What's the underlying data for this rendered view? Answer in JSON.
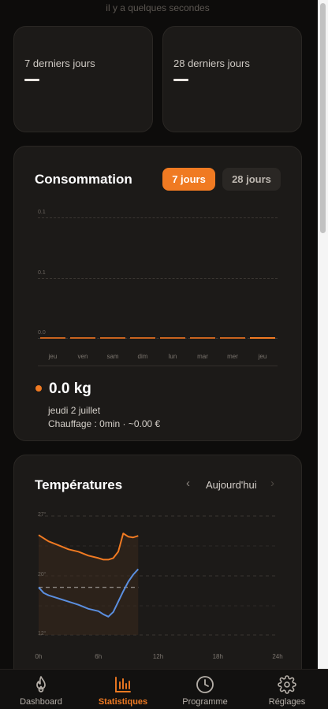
{
  "header": {
    "updated": "il y a quelques secondes"
  },
  "stats": [
    {
      "label": "7 derniers jours",
      "value": "—"
    },
    {
      "label": "28 derniers jours",
      "value": "—"
    }
  ],
  "consumption": {
    "title": "Consommation",
    "tabs": [
      {
        "label": "7 jours",
        "active": true
      },
      {
        "label": "28 jours",
        "active": false
      }
    ],
    "y_ticks": [
      "0.1",
      "0.1",
      "0.0"
    ],
    "summary": {
      "value": "0.0 kg",
      "date": "jeudi 2 juillet",
      "detail": "Chauffage : 0min · ~0.00 €"
    }
  },
  "temperatures": {
    "title": "Températures",
    "period": "Aujourd'hui",
    "prev_icon": "chevron-left-icon",
    "next_icon": "chevron-right-icon",
    "y_ticks": [
      "27°",
      "20°",
      "12°"
    ],
    "x_ticks": [
      "0h",
      "6h",
      "12h",
      "18h",
      "24h"
    ]
  },
  "chart_data": [
    {
      "type": "bar",
      "title": "Consommation",
      "categories": [
        "jeu",
        "ven",
        "sam",
        "dim",
        "lun",
        "mar",
        "mer",
        "jeu"
      ],
      "values": [
        0,
        0,
        0,
        0,
        0,
        0,
        0,
        0
      ],
      "y_ticks": [
        "0.1",
        "0.1",
        "0.0"
      ],
      "grid": true
    },
    {
      "type": "line",
      "title": "Températures",
      "x_ticks": [
        "0h",
        "6h",
        "12h",
        "18h",
        "24h"
      ],
      "y_ticks": [
        "27°",
        "20°",
        "12°"
      ],
      "ylim": [
        12,
        27
      ],
      "grid": true,
      "series": [
        {
          "x": [
            0,
            0.5,
            1,
            2,
            3,
            4,
            5,
            6,
            6.5,
            7,
            7.5,
            8,
            8.5,
            9,
            9.5,
            10
          ],
          "y": [
            24.6,
            24.2,
            23.8,
            23.3,
            22.8,
            22.5,
            22.0,
            21.7,
            21.5,
            21.5,
            21.7,
            22.5,
            24.8,
            24.4,
            24.3,
            24.5
          ]
        },
        {
          "x": [
            0,
            0.5,
            1,
            2,
            3,
            4,
            5,
            6,
            6.5,
            7,
            7.5,
            8,
            8.5,
            9,
            9.5,
            10
          ],
          "y": [
            18.0,
            17.3,
            17.0,
            16.6,
            16.2,
            15.8,
            15.3,
            15.0,
            14.6,
            14.3,
            14.9,
            16.2,
            17.5,
            18.7,
            19.6,
            20.3
          ]
        },
        {
          "x": [
            0,
            10
          ],
          "y": [
            18.0,
            18.0
          ]
        }
      ],
      "colors": [
        "#f07a22",
        "#5b8fe0",
        "#8a8580"
      ]
    }
  ],
  "nav": [
    {
      "label": "Dashboard",
      "icon": "flame-icon",
      "active": false
    },
    {
      "label": "Statistiques",
      "icon": "bar-chart-icon",
      "active": true
    },
    {
      "label": "Programme",
      "icon": "clock-icon",
      "active": false
    },
    {
      "label": "Réglages",
      "icon": "gear-icon",
      "active": false
    }
  ]
}
